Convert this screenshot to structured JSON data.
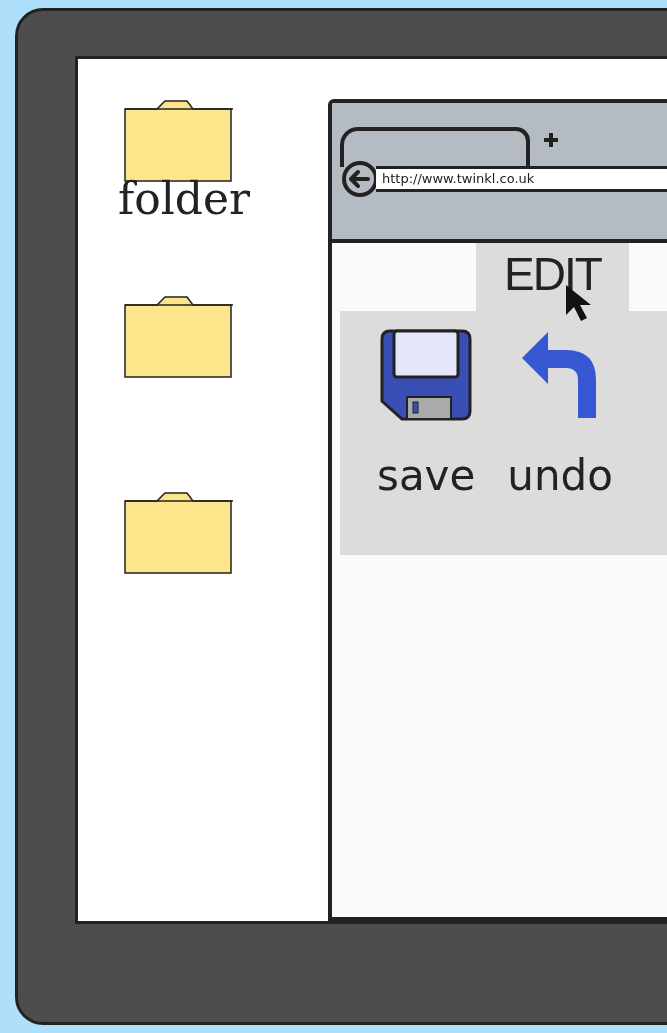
{
  "desktop": {
    "folders": [
      {
        "kind": "labeled",
        "label": "folder"
      },
      {
        "kind": "plain"
      },
      {
        "kind": "plain"
      }
    ]
  },
  "browser": {
    "address": "http://www.twinkl.co.uk",
    "menu_tabs": [
      {
        "label": "EDIT",
        "selected": true
      }
    ],
    "ribbon": [
      {
        "kind": "save",
        "label": "save"
      },
      {
        "kind": "undo",
        "label": "undo"
      }
    ]
  }
}
